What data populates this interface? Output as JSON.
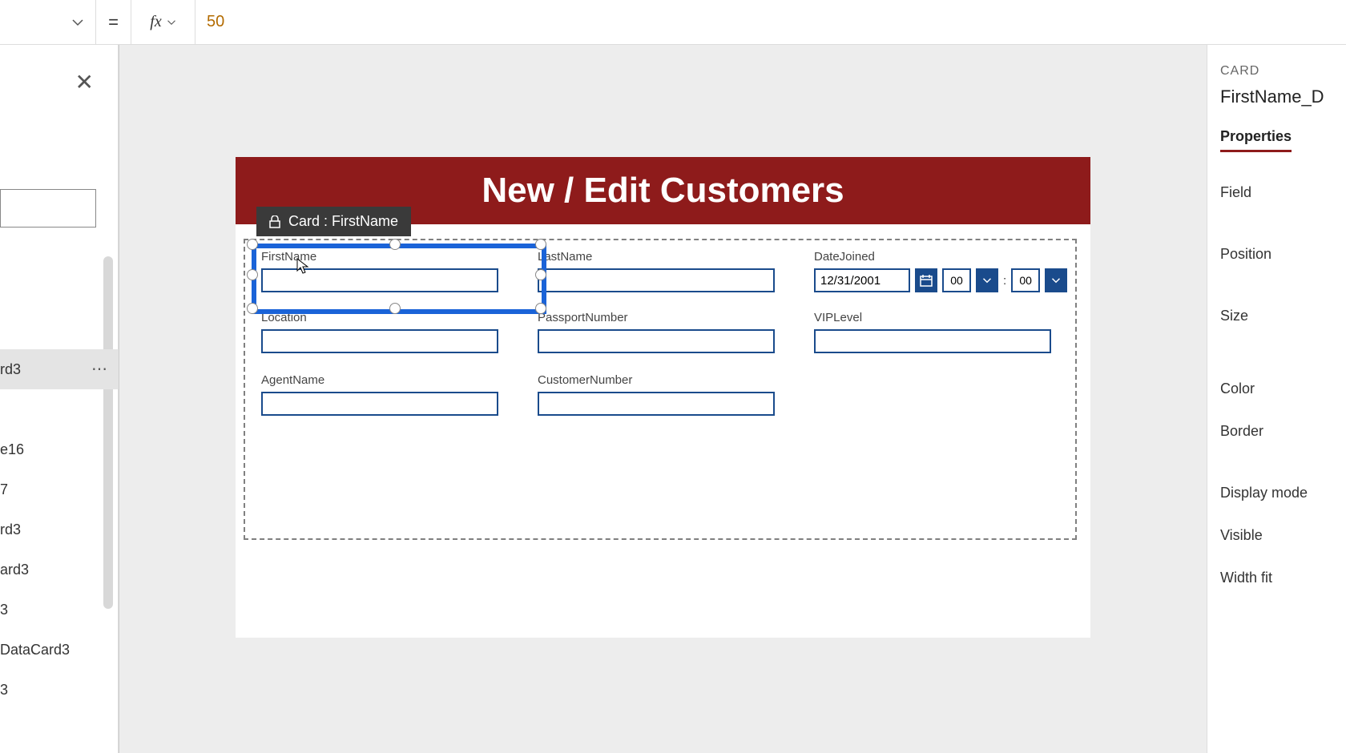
{
  "formula": {
    "value": "50",
    "equals": "="
  },
  "leftPanel": {
    "items": {
      "i0": "rd3",
      "i1": "",
      "i2": "e16",
      "i3": "7",
      "i4": "rd3",
      "i5": "ard3",
      "i6": "3",
      "i7": "DataCard3",
      "i8": "3"
    }
  },
  "screen": {
    "title": "New / Edit Customers"
  },
  "tooltip": {
    "label": "Card : FirstName"
  },
  "fields": {
    "firstname": {
      "label": "FirstName"
    },
    "lastname": {
      "label": "LastName"
    },
    "datejoined": {
      "label": "DateJoined",
      "date": "12/31/2001",
      "hour": "00",
      "min": "00",
      "colon": ":"
    },
    "location": {
      "label": "Location"
    },
    "passport": {
      "label": "PassportNumber"
    },
    "vip": {
      "label": "VIPLevel"
    },
    "agent": {
      "label": "AgentName"
    },
    "custnum": {
      "label": "CustomerNumber"
    }
  },
  "props": {
    "category": "CARD",
    "name": "FirstName_D",
    "tab": "Properties",
    "rows": {
      "field": "Field",
      "position": "Position",
      "size": "Size",
      "color": "Color",
      "border": "Border",
      "display": "Display mode",
      "visible": "Visible",
      "widthfit": "Width fit"
    }
  }
}
